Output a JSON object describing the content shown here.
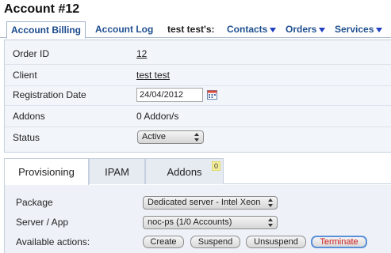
{
  "page_title": "Account #12",
  "topnav": {
    "account_billing": "Account Billing",
    "account_log": "Account Log",
    "user_label": "test test's:",
    "contacts": "Contacts",
    "orders": "Orders",
    "services": "Services"
  },
  "details": {
    "order_id": {
      "label": "Order ID",
      "value": "12"
    },
    "client": {
      "label": "Client",
      "value": "test test"
    },
    "registration_date": {
      "label": "Registration Date",
      "value": "24/04/2012"
    },
    "addons": {
      "label": "Addons",
      "value": "0 Addon/s"
    },
    "status": {
      "label": "Status",
      "value": "Active"
    }
  },
  "tabs": {
    "provisioning": "Provisioning",
    "ipam": "IPAM",
    "addons": "Addons",
    "addons_badge": "0"
  },
  "provisioning": {
    "package": {
      "label": "Package",
      "value": "Dedicated server - Intel Xeon"
    },
    "server": {
      "label": "Server / App",
      "value": "noc-ps (1/0 Accounts)"
    },
    "actions": {
      "label": "Available actions:",
      "create": "Create",
      "suspend": "Suspend",
      "unsuspend": "Unsuspend",
      "terminate": "Terminate"
    }
  },
  "colors": {
    "link": "#1f4f8f",
    "panel_bg": "#f2f5fa",
    "terminate_text": "#cc1a1a",
    "badge_bg": "#f3ee9a"
  }
}
